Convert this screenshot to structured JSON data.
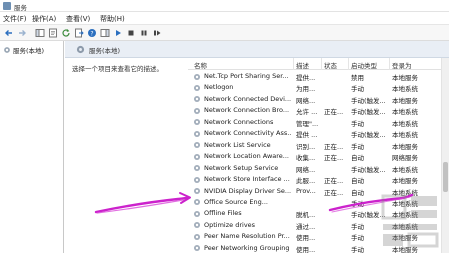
{
  "window": {
    "title": "服务"
  },
  "menu": {
    "items": [
      "文件(F)",
      "操作(A)",
      "查看(V)",
      "帮助(H)"
    ]
  },
  "toolbar": {
    "buttons": [
      "back-arrow-icon",
      "forward-arrow-icon",
      "console-tree-icon",
      "properties-icon",
      "refresh-icon",
      "export-list-icon",
      "help-icon",
      "show-hide-icon",
      "start-icon",
      "stop-icon",
      "pause-icon",
      "restart-icon"
    ]
  },
  "tree": {
    "root_label": "服务(本地)"
  },
  "main": {
    "header_title": "服务(本地)",
    "description_hint": "选择一个项目来查看它的描述。"
  },
  "table": {
    "columns": [
      "名称",
      "描述",
      "状态",
      "启动类型",
      "登录为"
    ],
    "rows": [
      {
        "name": "Net.Tcp Port Sharing Ser...",
        "desc": "提供...",
        "status": "",
        "startup": "禁用",
        "logon": "本地服务"
      },
      {
        "name": "Netlogon",
        "desc": "为用...",
        "status": "",
        "startup": "手动",
        "logon": "本地系统"
      },
      {
        "name": "Network Connected Devi...",
        "desc": "网络...",
        "status": "",
        "startup": "手动(触发...",
        "logon": "本地服务"
      },
      {
        "name": "Network Connection Bro...",
        "desc": "允许 ...",
        "status": "正在...",
        "startup": "手动(触发...",
        "logon": "本地系统"
      },
      {
        "name": "Network Connections",
        "desc": "管理\"...",
        "status": "",
        "startup": "手动",
        "logon": "本地系统"
      },
      {
        "name": "Network Connectivity Ass...",
        "desc": "提供 ...",
        "status": "",
        "startup": "手动(触发...",
        "logon": "本地系统"
      },
      {
        "name": "Network List Service",
        "desc": "识别...",
        "status": "正在...",
        "startup": "手动",
        "logon": "本地服务"
      },
      {
        "name": "Network Location Aware...",
        "desc": "收集...",
        "status": "正在...",
        "startup": "自动",
        "logon": "网络服务"
      },
      {
        "name": "Network Setup Service",
        "desc": "网络...",
        "status": "",
        "startup": "手动(触发...",
        "logon": "本地系统"
      },
      {
        "name": "Network Store Interface ...",
        "desc": "此服...",
        "status": "正在...",
        "startup": "自动",
        "logon": "本地服务"
      },
      {
        "name": "NVIDIA Display Driver Se...",
        "desc": "Prov...",
        "status": "正在...",
        "startup": "自动",
        "logon": "本地系统"
      },
      {
        "name": "Office Source Eng...",
        "desc": "",
        "status": "",
        "startup": "手动",
        "logon": "本地系统"
      },
      {
        "name": "Offline Files",
        "desc": "脱机...",
        "status": "",
        "startup": "手动(触发...",
        "logon": "本地系统"
      },
      {
        "name": "Optimize drives",
        "desc": "通过...",
        "status": "",
        "startup": "手动",
        "logon": "本地系统"
      },
      {
        "name": "Peer Name Resolution Pr...",
        "desc": "使用...",
        "status": "",
        "startup": "手动",
        "logon": "本地服务"
      },
      {
        "name": "Peer Networking Grouping",
        "desc": "使用...",
        "status": "",
        "startup": "手动",
        "logon": "本地服务"
      }
    ]
  },
  "colors": {
    "annotation_stroke": "#cc22cc",
    "header_band": "#e9eef5"
  }
}
